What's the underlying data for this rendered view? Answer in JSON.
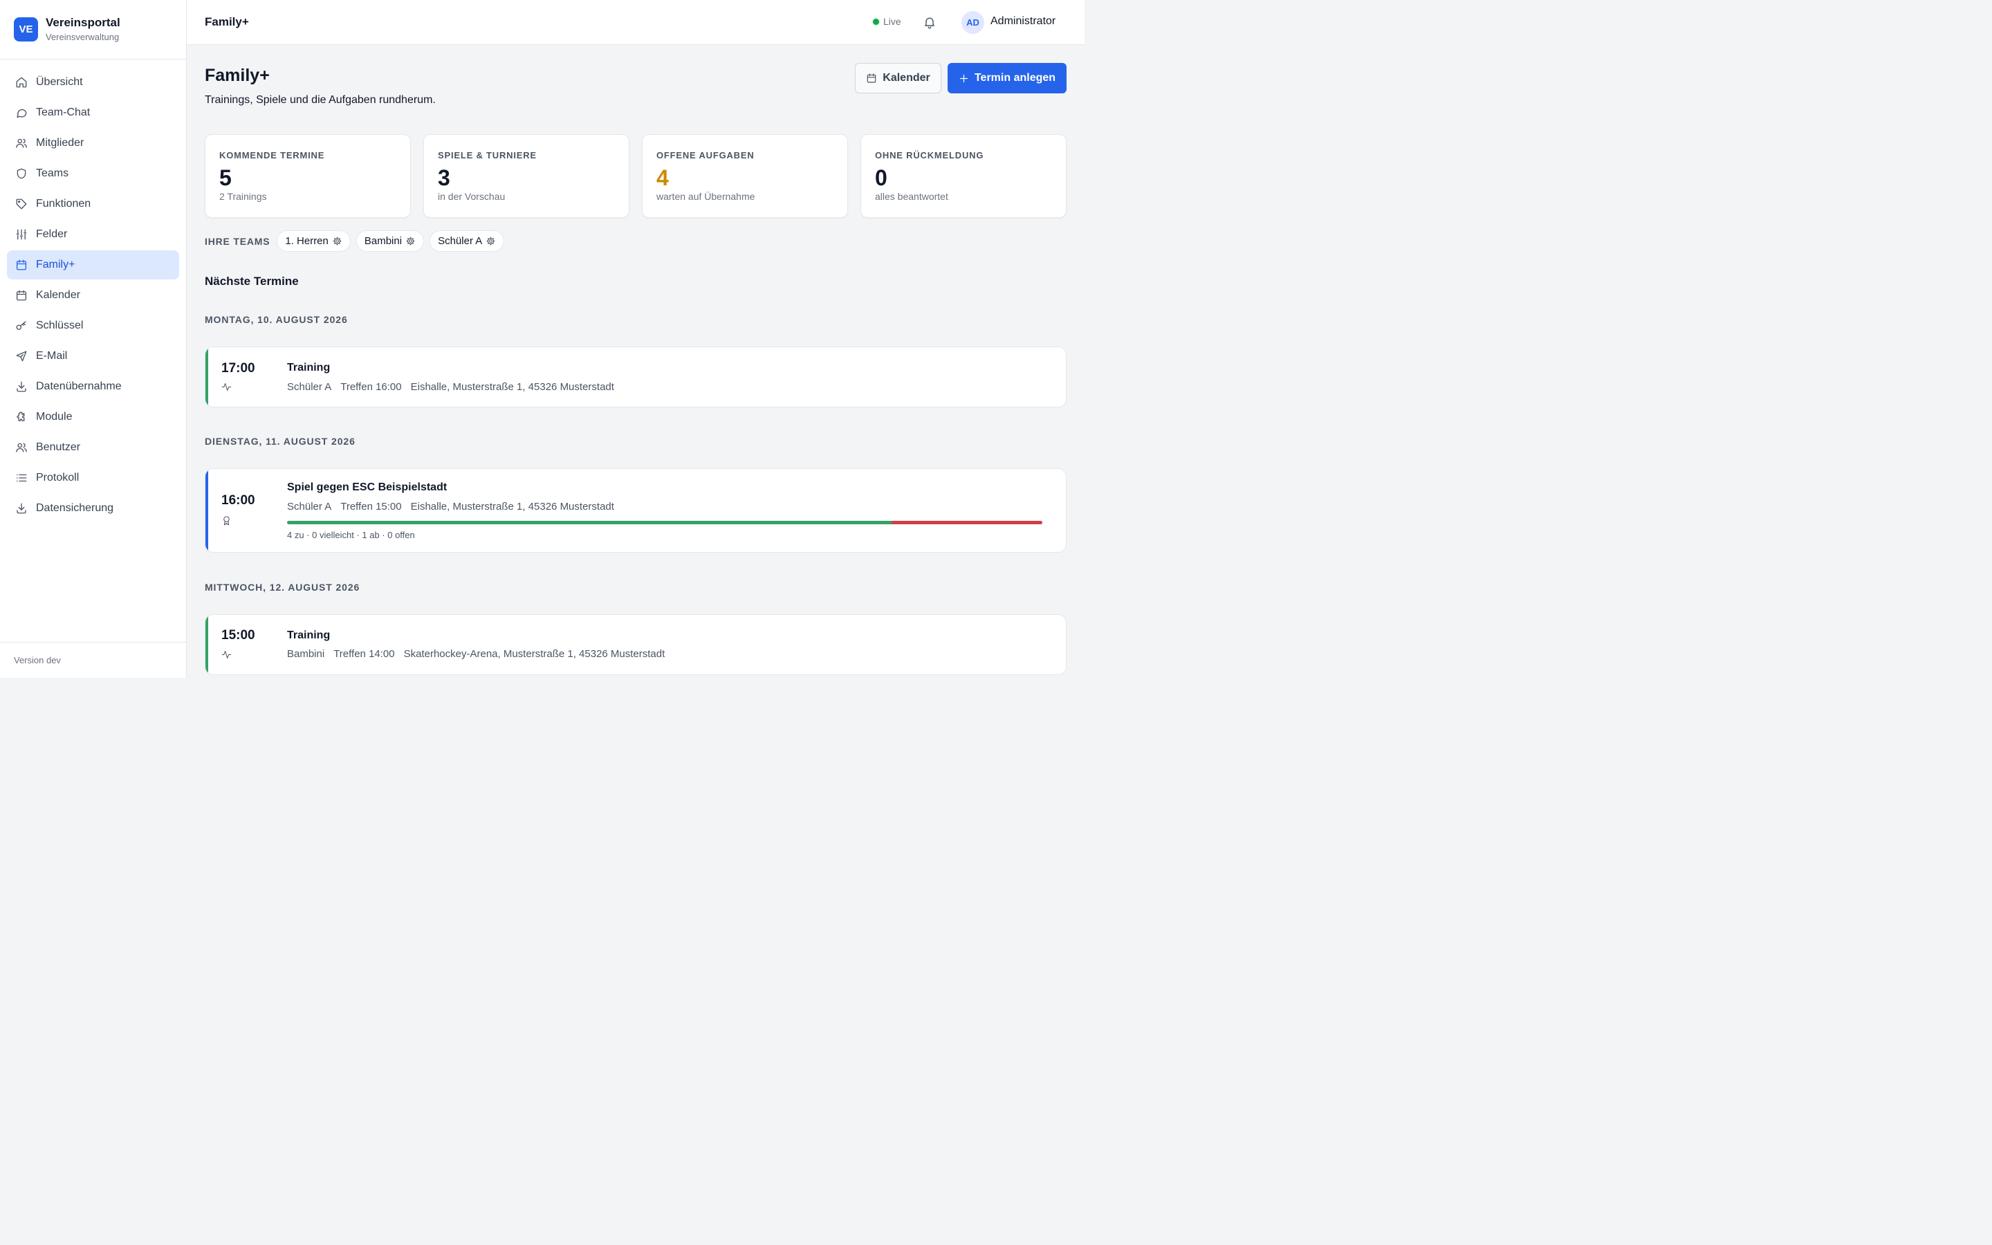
{
  "brand": {
    "logo": "VE",
    "title": "Vereinsportal",
    "subtitle": "Vereinsverwaltung"
  },
  "nav": [
    {
      "label": "Übersicht",
      "icon": "home-icon"
    },
    {
      "label": "Team-Chat",
      "icon": "chat-icon"
    },
    {
      "label": "Mitglieder",
      "icon": "users-icon"
    },
    {
      "label": "Teams",
      "icon": "shield-icon"
    },
    {
      "label": "Funktionen",
      "icon": "tag-icon"
    },
    {
      "label": "Felder",
      "icon": "sliders-icon"
    },
    {
      "label": "Family+",
      "icon": "calendar-icon",
      "active": true
    },
    {
      "label": "Kalender",
      "icon": "calendar-icon"
    },
    {
      "label": "Schlüssel",
      "icon": "key-icon"
    },
    {
      "label": "E-Mail",
      "icon": "send-icon"
    },
    {
      "label": "Datenübernahme",
      "icon": "download-icon"
    },
    {
      "label": "Module",
      "icon": "puzzle-icon"
    },
    {
      "label": "Benutzer",
      "icon": "users-icon"
    },
    {
      "label": "Protokoll",
      "icon": "list-icon"
    },
    {
      "label": "Datensicherung",
      "icon": "download-icon"
    }
  ],
  "version": "Version dev",
  "topbar": {
    "title": "Family+",
    "live": "Live",
    "avatar": "AD",
    "user": "Administrator"
  },
  "page": {
    "title": "Family+",
    "subtitle": "Trainings, Spiele und die Aufgaben rundherum.",
    "calendar_button": "Kalender",
    "new_button": "Termin anlegen"
  },
  "stats": [
    {
      "label": "KOMMENDE TERMINE",
      "value": "5",
      "hint": "2 Trainings"
    },
    {
      "label": "SPIELE & TURNIERE",
      "value": "3",
      "hint": "in der Vorschau"
    },
    {
      "label": "OFFENE AUFGABEN",
      "value": "4",
      "hint": "warten auf Übernahme",
      "color": "#ca8a04"
    },
    {
      "label": "OHNE RÜCKMELDUNG",
      "value": "0",
      "hint": "alles beantwortet"
    }
  ],
  "teams": {
    "label": "IHRE TEAMS",
    "items": [
      "1. Herren",
      "Bambini",
      "Schüler A"
    ]
  },
  "section_title": "Nächste Termine",
  "days": [
    {
      "label": "MONTAG, 10. AUGUST 2026",
      "event": {
        "time": "17:00",
        "icon": "activity-icon",
        "title": "Training",
        "team": "Schüler A",
        "meet": "Treffen 16:00",
        "location": "Eishalle, Musterstraße 1, 45326 Musterstadt",
        "accent": "#34a265"
      }
    },
    {
      "label": "DIENSTAG, 11. AUGUST 2026",
      "event": {
        "time": "16:00",
        "icon": "award-icon",
        "title": "Spiel gegen ESC Beispielstadt",
        "team": "Schüler A",
        "meet": "Treffen 15:00",
        "location": "Eishalle, Musterstraße 1, 45326 Musterstadt",
        "accent": "#2563eb",
        "responses": {
          "yes": 4,
          "maybe": 0,
          "no": 1,
          "open": 0,
          "summary": "4 zu · 0 vielleicht · 1 ab · 0 offen"
        }
      }
    },
    {
      "label": "MITTWOCH, 12. AUGUST 2026",
      "event": {
        "time": "15:00",
        "icon": "activity-icon",
        "title": "Training",
        "team": "Bambini",
        "meet": "Treffen 14:00",
        "location": "Skaterhockey-Arena, Musterstraße 1, 45326 Musterstadt",
        "accent": "#34a265"
      }
    }
  ]
}
